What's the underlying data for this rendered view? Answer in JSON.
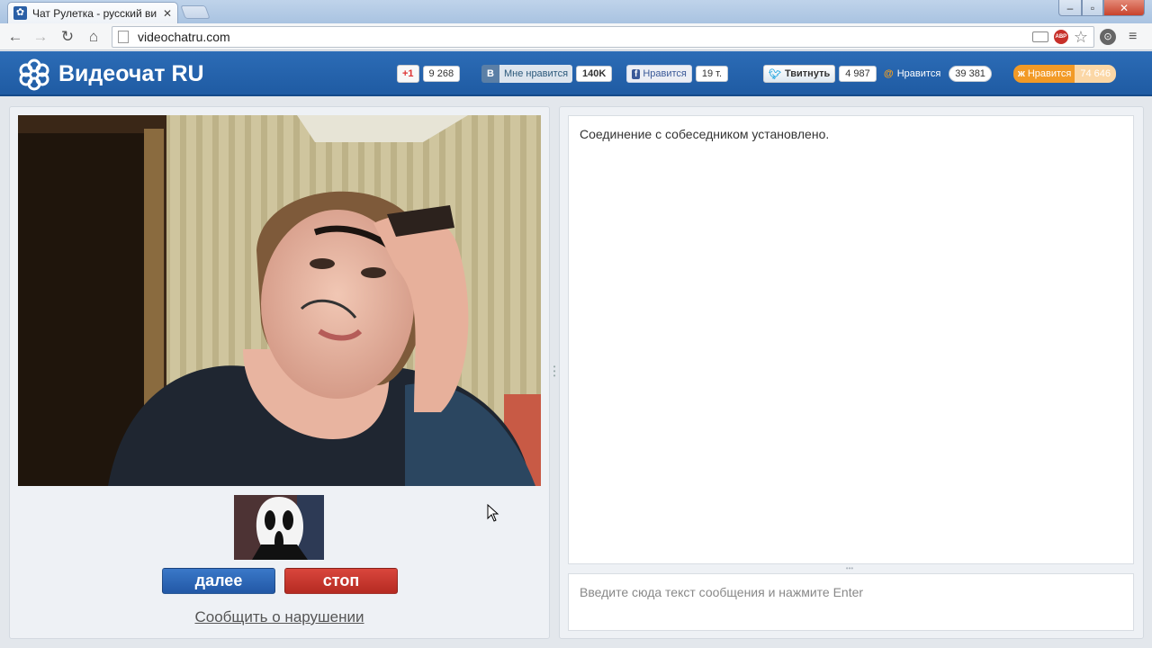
{
  "browser": {
    "tab_title": "Чат Рулетка - русский ви",
    "tab_close": "✕",
    "url": "videochatru.com"
  },
  "site": {
    "logo_text": "Видеочат RU"
  },
  "share": {
    "gplus": {
      "label": "+1",
      "count": "9 268"
    },
    "vk": {
      "logo": "В",
      "label": "Мне нравится",
      "count": "140K"
    },
    "facebook": {
      "label": "Нравится",
      "count": "19 т."
    },
    "twitter": {
      "label": "Твитнуть",
      "count": "4 987"
    },
    "mailru": {
      "label": "Нравится",
      "count": "39 381"
    },
    "odnoklassniki": {
      "label": "Нравится",
      "count": "74 646"
    }
  },
  "video": {
    "next_label": "далее",
    "stop_label": "стоп",
    "report_link": "Сообщить о нарушении"
  },
  "chat": {
    "messages": [
      "Соединение с собеседником установлено."
    ],
    "input_placeholder": "Введите сюда текст сообщения и нажмите Enter"
  },
  "icons": {
    "tab_favicon": "videochat-logo-icon",
    "back": "arrow-left-icon",
    "forward": "arrow-right-icon",
    "reload": "reload-icon",
    "home": "home-icon",
    "bookmark": "star-icon",
    "menu": "hamburger-menu-icon"
  },
  "colors": {
    "header_blue": "#2566b0",
    "next_button": "#2a62b2",
    "stop_button": "#c6352c"
  }
}
